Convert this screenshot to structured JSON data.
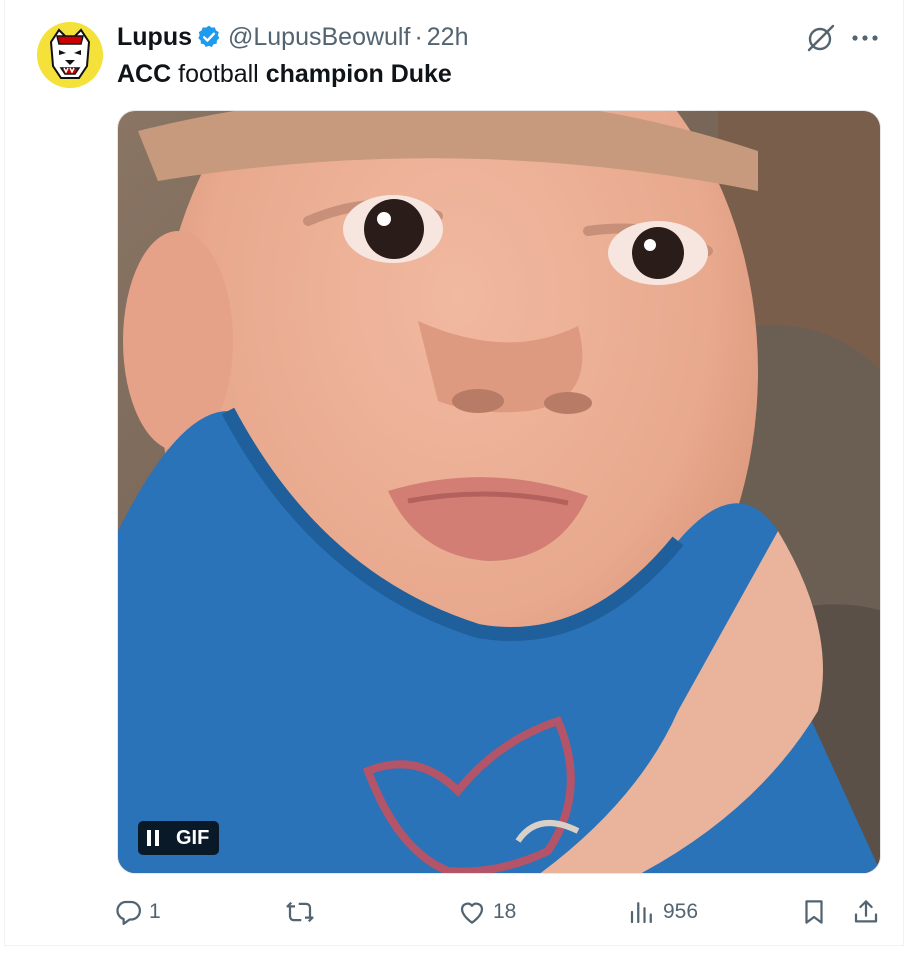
{
  "tweet": {
    "author_name": "Lupus",
    "handle": "@LupusBeowulf",
    "separator": "·",
    "time": "22h",
    "text_parts": [
      {
        "text": "ACC",
        "bold": true
      },
      {
        "text": " football ",
        "bold": false
      },
      {
        "text": "champion Duke",
        "bold": true
      }
    ],
    "media": {
      "badge_label": "GIF",
      "state": "playing"
    },
    "metrics": {
      "replies": "1",
      "reposts": "",
      "likes": "18",
      "views": "956"
    }
  },
  "icons": {
    "verified": "verified-badge-icon",
    "grok": "grok-icon",
    "more": "more-icon",
    "reply": "reply-icon",
    "repost": "repost-icon",
    "like": "heart-icon",
    "views": "views-icon",
    "bookmark": "bookmark-icon",
    "share": "share-icon"
  },
  "colors": {
    "text_primary": "#0f1419",
    "text_secondary": "#536471",
    "verified_blue": "#1d9bf0",
    "avatar_bg": "#f4e23a",
    "shirt_blue": "#2a73b8"
  }
}
